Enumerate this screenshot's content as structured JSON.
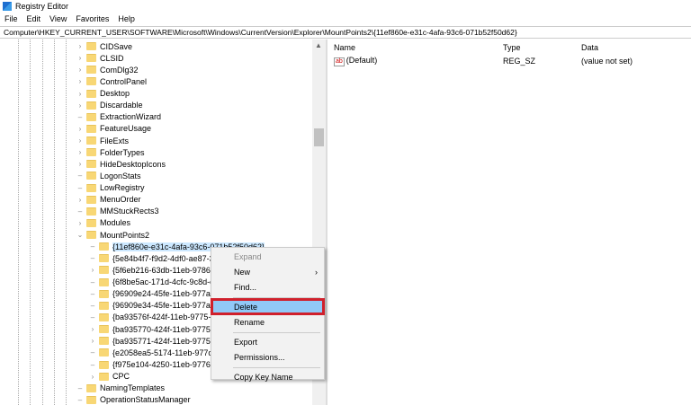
{
  "window": {
    "title": "Registry Editor",
    "icon": "registry-editor-icon"
  },
  "menubar": [
    "File",
    "Edit",
    "View",
    "Favorites",
    "Help"
  ],
  "address": "Computer\\HKEY_CURRENT_USER\\SOFTWARE\\Microsoft\\Windows\\CurrentVersion\\Explorer\\MountPoints2\\{11ef860e-e31c-4afa-93c6-071b52f50d62}",
  "tree": [
    {
      "label": "CIDSave",
      "exp": ">",
      "lvl": 0
    },
    {
      "label": "CLSID",
      "exp": ">",
      "lvl": 0
    },
    {
      "label": "ComDlg32",
      "exp": ">",
      "lvl": 0
    },
    {
      "label": "ControlPanel",
      "exp": ">",
      "lvl": 0
    },
    {
      "label": "Desktop",
      "exp": ">",
      "lvl": 0
    },
    {
      "label": "Discardable",
      "exp": ">",
      "lvl": 0
    },
    {
      "label": "ExtractionWizard",
      "exp": "",
      "lvl": 0
    },
    {
      "label": "FeatureUsage",
      "exp": ">",
      "lvl": 0
    },
    {
      "label": "FileExts",
      "exp": ">",
      "lvl": 0
    },
    {
      "label": "FolderTypes",
      "exp": ">",
      "lvl": 0
    },
    {
      "label": "HideDesktopIcons",
      "exp": ">",
      "lvl": 0
    },
    {
      "label": "LogonStats",
      "exp": "",
      "lvl": 0
    },
    {
      "label": "LowRegistry",
      "exp": "",
      "lvl": 0
    },
    {
      "label": "MenuOrder",
      "exp": ">",
      "lvl": 0
    },
    {
      "label": "MMStuckRects3",
      "exp": "",
      "lvl": 0
    },
    {
      "label": "Modules",
      "exp": ">",
      "lvl": 0
    },
    {
      "label": "MountPoints2",
      "exp": "v",
      "lvl": 0
    },
    {
      "label": "{11ef860e-e31c-4afa-93c6-071b52f50d62}",
      "exp": "",
      "lvl": 1,
      "selected": true
    },
    {
      "label": "{5e84b4f7-f9d2-4df0-ae87-3e",
      "exp": "",
      "lvl": 1
    },
    {
      "label": "{5f6eb216-63db-11eb-9786-5",
      "exp": ">",
      "lvl": 1
    },
    {
      "label": "{6f8be5ac-171d-4cfc-9c8d-cl",
      "exp": "",
      "lvl": 1
    },
    {
      "label": "{96909e24-45fe-11eb-977a-54",
      "exp": "",
      "lvl": 1
    },
    {
      "label": "{96909e34-45fe-11eb-977a-54",
      "exp": "",
      "lvl": 1
    },
    {
      "label": "{ba93576f-424f-11eb-9775-80",
      "exp": "",
      "lvl": 1
    },
    {
      "label": "{ba935770-424f-11eb-9775-80",
      "exp": ">",
      "lvl": 1
    },
    {
      "label": "{ba935771-424f-11eb-9775-80",
      "exp": ">",
      "lvl": 1
    },
    {
      "label": "{e2058ea5-5174-11eb-977c-54",
      "exp": "",
      "lvl": 1
    },
    {
      "label": "{f975e104-4250-11eb-9776-54",
      "exp": "",
      "lvl": 1
    },
    {
      "label": "CPC",
      "exp": ">",
      "lvl": 1
    },
    {
      "label": "NamingTemplates",
      "exp": "",
      "lvl": 0
    },
    {
      "label": "OperationStatusManager",
      "exp": "",
      "lvl": 0
    }
  ],
  "list": {
    "headers": {
      "name": "Name",
      "type": "Type",
      "data": "Data"
    },
    "rows": [
      {
        "name": "(Default)",
        "type": "REG_SZ",
        "data": "(value not set)",
        "icon": "ab"
      }
    ]
  },
  "context_menu": [
    {
      "label": "Expand",
      "disabled": true
    },
    {
      "label": "New",
      "submenu": true
    },
    {
      "label": "Find..."
    },
    {
      "sep": true
    },
    {
      "label": "Delete",
      "highlighted": true
    },
    {
      "label": "Rename"
    },
    {
      "sep": true
    },
    {
      "label": "Export"
    },
    {
      "label": "Permissions..."
    },
    {
      "sep": true
    },
    {
      "label": "Copy Key Name"
    }
  ],
  "colors": {
    "highlight": "#91c9f7",
    "annotation_box": "#d0202c",
    "folder": "#f8d775"
  }
}
